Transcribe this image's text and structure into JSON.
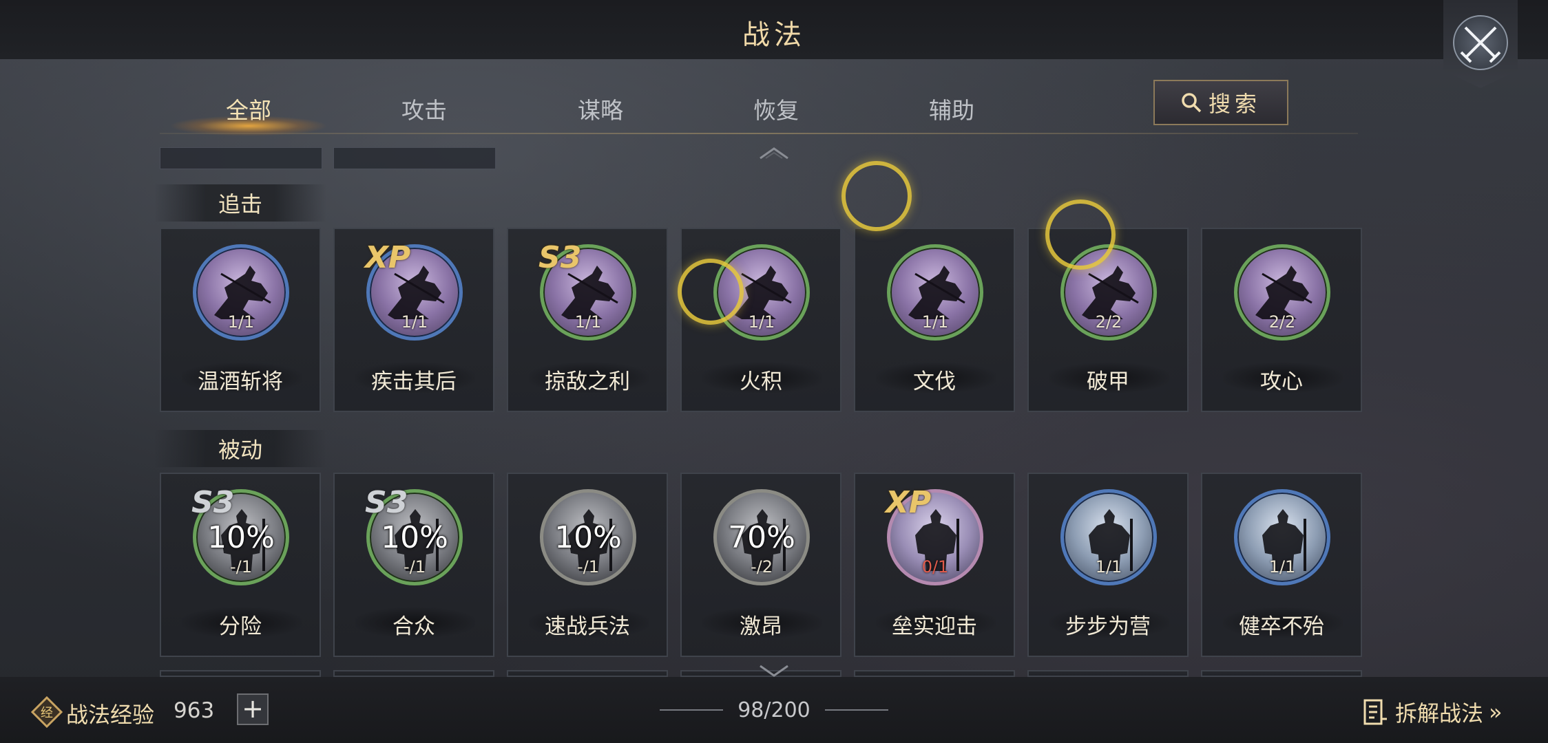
{
  "header": {
    "title": "战法"
  },
  "tabs": [
    {
      "label": "全部",
      "active": true
    },
    {
      "label": "攻击",
      "active": false
    },
    {
      "label": "谋略",
      "active": false
    },
    {
      "label": "恢复",
      "active": false
    },
    {
      "label": "辅助",
      "active": false
    }
  ],
  "search": {
    "label": "搜索"
  },
  "sections": [
    {
      "label": "追击",
      "cards": [
        {
          "name": "温酒斩将",
          "level": "1/1",
          "badge": "",
          "ring": "blue",
          "medal": "purple"
        },
        {
          "name": "疾击其后",
          "level": "1/1",
          "badge": "XP",
          "ring": "blue",
          "medal": "purple"
        },
        {
          "name": "掠敌之利",
          "level": "1/1",
          "badge": "S3",
          "ring": "green",
          "medal": "purple"
        },
        {
          "name": "火积",
          "level": "1/1",
          "badge": "",
          "ring": "green",
          "medal": "purple"
        },
        {
          "name": "文伐",
          "level": "1/1",
          "badge": "",
          "ring": "green",
          "medal": "purple"
        },
        {
          "name": "破甲",
          "level": "2/2",
          "badge": "",
          "ring": "green",
          "medal": "purple"
        },
        {
          "name": "攻心",
          "level": "2/2",
          "badge": "",
          "ring": "green",
          "medal": "purple"
        }
      ]
    },
    {
      "label": "被动",
      "cards": [
        {
          "name": "分险",
          "level": "-/1",
          "badge": "S3",
          "percent": "10%",
          "ring": "green",
          "medal": "grey"
        },
        {
          "name": "合众",
          "level": "-/1",
          "badge": "S3",
          "percent": "10%",
          "ring": "green",
          "medal": "grey"
        },
        {
          "name": "速战兵法",
          "level": "-/1",
          "badge": "",
          "percent": "10%",
          "ring": "grey",
          "medal": "grey"
        },
        {
          "name": "激昂",
          "level": "-/2",
          "badge": "",
          "percent": "70%",
          "ring": "grey",
          "medal": "grey"
        },
        {
          "name": "垒实迎击",
          "level": "0/1",
          "badge": "XP",
          "ring": "pink",
          "medal": "lavender"
        },
        {
          "name": "步步为营",
          "level": "1/1",
          "badge": "",
          "ring": "blue",
          "medal": "blue"
        },
        {
          "name": "健卒不殆",
          "level": "1/1",
          "badge": "",
          "ring": "blue",
          "medal": "blue"
        }
      ]
    }
  ],
  "footer": {
    "exp_label": "战法经验",
    "exp_value": "963",
    "plus": "+",
    "count": "98/200",
    "disband_label": "拆解战法"
  },
  "icons": [
    "close-swords-icon",
    "search-icon",
    "exp-token-icon",
    "disband-list-icon",
    "chevron-up-icon",
    "chevron-down-icon"
  ]
}
